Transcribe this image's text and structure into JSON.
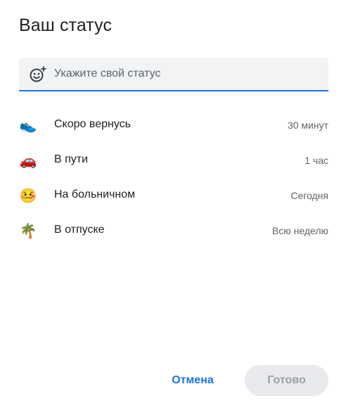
{
  "dialog": {
    "title": "Ваш статус"
  },
  "status_input": {
    "placeholder": "Укажите свой статус",
    "value": "",
    "icon": "add-emoji-icon",
    "accent_color": "#1a73e8"
  },
  "presets": [
    {
      "emoji": "👟",
      "icon": "sneaker-icon",
      "label": "Скоро вернусь",
      "duration": "30 минут"
    },
    {
      "emoji": "🚗",
      "icon": "car-icon",
      "label": "В пути",
      "duration": "1 час"
    },
    {
      "emoji": "🤒",
      "icon": "sick-face-icon",
      "label": "На больничном",
      "duration": "Сегодня"
    },
    {
      "emoji": "🌴",
      "icon": "palm-tree-icon",
      "label": "В отпуске",
      "duration": "Всю неделю"
    }
  ],
  "actions": {
    "cancel_label": "Отмена",
    "done_label": "Готово",
    "done_enabled": false
  }
}
